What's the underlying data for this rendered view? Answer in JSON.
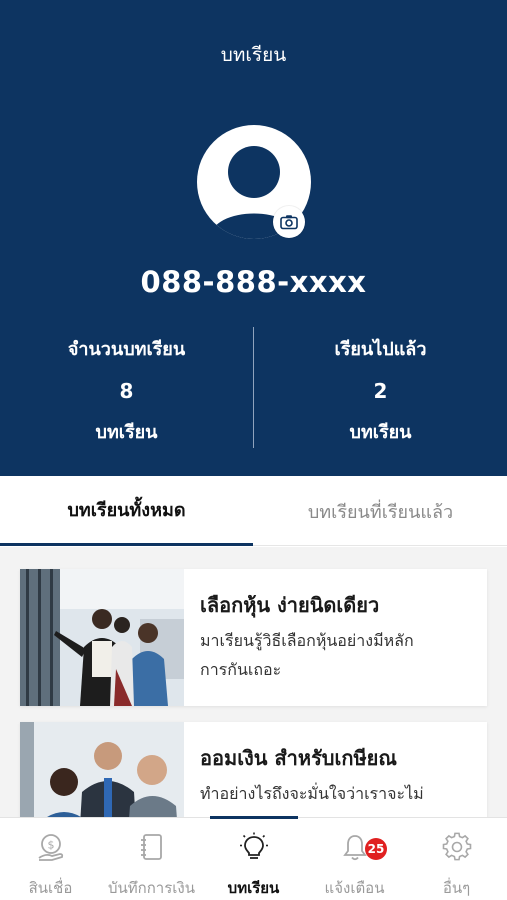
{
  "header": {
    "title": "บทเรียน",
    "phone": "088-888-xxxx",
    "stats": [
      {
        "label": "จำนวนบทเรียน",
        "value": "8",
        "unit": "บทเรียน"
      },
      {
        "label": "เรียนไปแล้ว",
        "value": "2",
        "unit": "บทเรียน"
      }
    ]
  },
  "tabs": [
    {
      "label": "บทเรียนทั้งหมด",
      "active": true
    },
    {
      "label": "บทเรียนที่เรียนแล้ว",
      "active": false
    }
  ],
  "lessons": [
    {
      "title": "เลือกหุ้น ง่ายนิดเดียว",
      "desc_line1": "มาเรียนรู้วิธีเลือกหุ้นอย่างมีหลัก",
      "desc_line2": "การกันเถอะ"
    },
    {
      "title": "ออมเงิน สำหรับเกษียณ",
      "desc_line1": "ทำอย่างไรถึงจะมั่นใจว่าเราจะไม่",
      "desc_line2": ""
    }
  ],
  "bottom_nav": [
    {
      "label": "สินเชื่อ",
      "icon": "loan-icon",
      "active": false
    },
    {
      "label": "บันทึกการเงิน",
      "icon": "notebook-icon",
      "active": false
    },
    {
      "label": "บทเรียน",
      "icon": "lightbulb-icon",
      "active": true
    },
    {
      "label": "แจ้งเตือน",
      "icon": "bell-icon",
      "active": false,
      "badge": "25"
    },
    {
      "label": "อื่นๆ",
      "icon": "gear-icon",
      "active": false
    }
  ],
  "colors": {
    "primary": "#0d3461",
    "badge": "#e02020",
    "inactive": "#9a9a9a"
  }
}
